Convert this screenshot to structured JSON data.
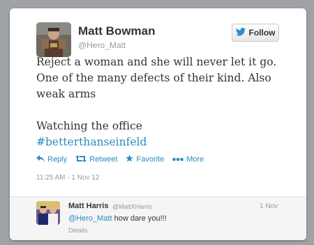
{
  "tweet": {
    "author_name": "Matt Bowman",
    "author_handle": "@Hero_Matt",
    "follow_label": "Follow",
    "text_line1": "Reject a woman and she will never let it go.",
    "text_line2": "One of the many defects of their kind. Also",
    "text_line3": "weak arms",
    "text_line4": "Watching the office",
    "hashtag": "#betterthanseinfeld",
    "actions": {
      "reply": "Reply",
      "retweet": "Retweet",
      "favorite": "Favorite",
      "more": "More"
    },
    "timestamp": "11:25 AM - 1 Nov 12"
  },
  "reply": {
    "author_name": "Matt Harris",
    "author_handle": "@MattXHarris",
    "date": "1 Nov",
    "mention": "@Hero_Matt",
    "text": " how dare you!!!",
    "details_label": "Details"
  },
  "colors": {
    "link": "#2a8bc0",
    "text": "#333333",
    "muted": "#999999",
    "background": "#9fa3a6"
  },
  "icons": {
    "follow": "twitter-bird-icon",
    "reply": "reply-arrow-icon",
    "retweet": "retweet-icon",
    "favorite": "star-icon",
    "more": "dots-icon"
  }
}
